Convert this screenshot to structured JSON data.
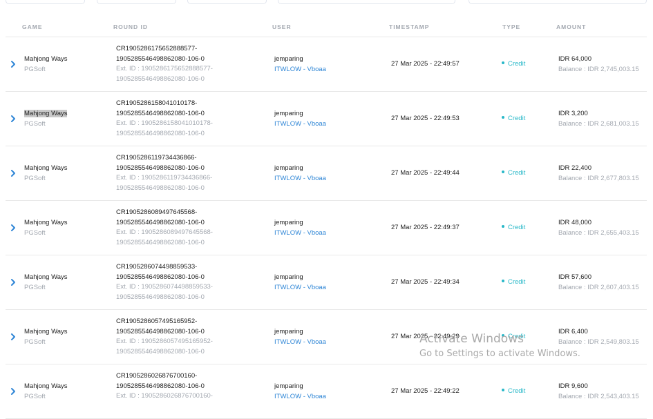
{
  "table": {
    "headers": {
      "game": "GAME",
      "round_id": "ROUND ID",
      "user": "USER",
      "timestamp": "TIMESTAMP",
      "type": "TYPE",
      "amount": "AMOUNT"
    },
    "rows": [
      {
        "game": "Mahjong Ways",
        "provider": "PGSoft",
        "round_1": "CR1905286175652888577-",
        "round_2": "1905285546498862080-106-0",
        "ext_1": "Ext. ID : 1905286175652888577-",
        "ext_2": "1905285546498862080-106-0",
        "user": "jemparing",
        "agent": "ITWLOW - Vboaa",
        "timestamp": "27 Mar 2025 - 22:49:57",
        "type": "Credit",
        "amount": "IDR 64,000",
        "balance": "Balance : IDR 2,745,003.15",
        "highlighted": false
      },
      {
        "game": "Mahjong Ways",
        "provider": "PGSoft",
        "round_1": "CR1905286158041010178-",
        "round_2": "1905285546498862080-106-0",
        "ext_1": "Ext. ID : 1905286158041010178-",
        "ext_2": "1905285546498862080-106-0",
        "user": "jemparing",
        "agent": "ITWLOW - Vboaa",
        "timestamp": "27 Mar 2025 - 22:49:53",
        "type": "Credit",
        "amount": "IDR 3,200",
        "balance": "Balance : IDR 2,681,003.15",
        "highlighted": true
      },
      {
        "game": "Mahjong Ways",
        "provider": "PGSoft",
        "round_1": "CR1905286119734436866-",
        "round_2": "1905285546498862080-106-0",
        "ext_1": "Ext. ID : 1905286119734436866-",
        "ext_2": "1905285546498862080-106-0",
        "user": "jemparing",
        "agent": "ITWLOW - Vboaa",
        "timestamp": "27 Mar 2025 - 22:49:44",
        "type": "Credit",
        "amount": "IDR 22,400",
        "balance": "Balance : IDR 2,677,803.15",
        "highlighted": false
      },
      {
        "game": "Mahjong Ways",
        "provider": "PGSoft",
        "round_1": "CR1905286089497645568-",
        "round_2": "1905285546498862080-106-0",
        "ext_1": "Ext. ID : 1905286089497645568-",
        "ext_2": "1905285546498862080-106-0",
        "user": "jemparing",
        "agent": "ITWLOW - Vboaa",
        "timestamp": "27 Mar 2025 - 22:49:37",
        "type": "Credit",
        "amount": "IDR 48,000",
        "balance": "Balance : IDR 2,655,403.15",
        "highlighted": false
      },
      {
        "game": "Mahjong Ways",
        "provider": "PGSoft",
        "round_1": "CR1905286074498859533-",
        "round_2": "1905285546498862080-106-0",
        "ext_1": "Ext. ID : 1905286074498859533-",
        "ext_2": "1905285546498862080-106-0",
        "user": "jemparing",
        "agent": "ITWLOW - Vboaa",
        "timestamp": "27 Mar 2025 - 22:49:34",
        "type": "Credit",
        "amount": "IDR 57,600",
        "balance": "Balance : IDR 2,607,403.15",
        "highlighted": false
      },
      {
        "game": "Mahjong Ways",
        "provider": "PGSoft",
        "round_1": "CR1905286057495165952-",
        "round_2": "1905285546498862080-106-0",
        "ext_1": "Ext. ID : 1905286057495165952-",
        "ext_2": "1905285546498862080-106-0",
        "user": "jemparing",
        "agent": "ITWLOW - Vboaa",
        "timestamp": "27 Mar 2025 - 22:49:29",
        "type": "Credit",
        "amount": "IDR 6,400",
        "balance": "Balance : IDR 2,549,803.15",
        "highlighted": false
      },
      {
        "game": "Mahjong Ways",
        "provider": "PGSoft",
        "round_1": "CR1905286026876700160-",
        "round_2": "1905285546498862080-106-0",
        "ext_1": "Ext. ID : 1905286026876700160-",
        "ext_2": "",
        "user": "jemparing",
        "agent": "ITWLOW - Vboaa",
        "timestamp": "27 Mar 2025 - 22:49:22",
        "type": "Credit",
        "amount": "IDR 9,600",
        "balance": "Balance : IDR 2,543,403.15",
        "highlighted": false
      }
    ]
  },
  "watermark": {
    "line1": "Activate Windows",
    "line2": "Go to Settings to activate Windows."
  },
  "colors": {
    "link": "#2f86d6",
    "credit": "#28b8c8",
    "muted": "#a3a8b0"
  },
  "icons": {
    "expand": "chevron-right-icon"
  }
}
